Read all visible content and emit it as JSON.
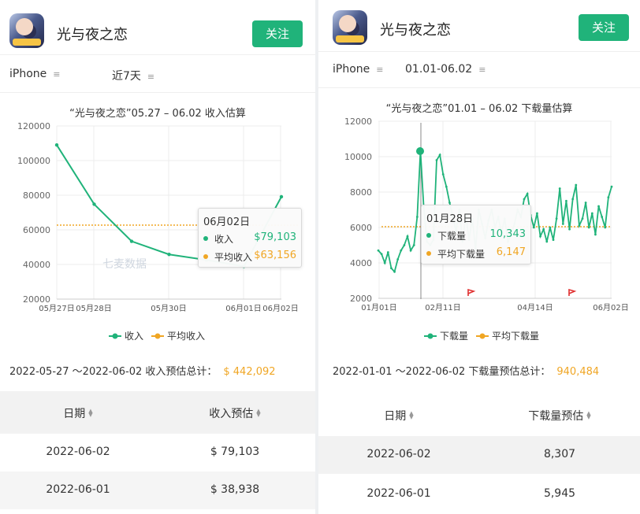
{
  "colors": {
    "green": "#20b37a",
    "orange": "#f0a624"
  },
  "left": {
    "app": {
      "title": "光与夜之恋",
      "follow": "关注",
      "icon": "app-icon"
    },
    "filters": {
      "device": "iPhone",
      "range": "近7天",
      "sort_icon": "≡"
    },
    "chart_data": {
      "type": "line",
      "title": "“光与夜之恋”05.27 – 06.02 收入估算",
      "x_ticks": [
        "05月27日",
        "05月28日",
        "05月30日",
        "06月01日",
        "06月02日"
      ],
      "y_ticks": [
        "120000",
        "100000",
        "80000",
        "60000",
        "40000",
        "20000"
      ],
      "ylim": [
        20000,
        120000
      ],
      "x": [
        "05-27",
        "05-28",
        "05-29",
        "05-30",
        "05-31",
        "06-01",
        "06-02"
      ],
      "series": [
        {
          "name": "收入",
          "values": [
            109000,
            74800,
            53400,
            45800,
            42600,
            38938,
            79103
          ]
        },
        {
          "name": "平均收入",
          "values": [
            63156,
            63156,
            63156,
            63156,
            63156,
            63156,
            63156
          ]
        }
      ],
      "watermark": "七麦数据",
      "tooltip": {
        "date": "06月02日",
        "row1_label": "收入",
        "row1_value": "$79,103",
        "row2_label": "平均收入",
        "row2_value": "$63,156"
      }
    },
    "legend": [
      "收入",
      "平均收入"
    ],
    "total": {
      "label": "2022-05-27 ～2022-06-02 收入预估总计：",
      "value": "$ 442,092"
    },
    "table": {
      "headers": [
        "日期",
        "收入预估"
      ],
      "rows": [
        [
          "2022-06-02",
          "$ 79,103"
        ],
        [
          "2022-06-01",
          "$ 38,938"
        ]
      ]
    }
  },
  "right": {
    "app": {
      "title": "光与夜之恋",
      "follow": "关注",
      "icon": "app-icon"
    },
    "filters": {
      "device": "iPhone",
      "range": "01.01-06.02",
      "sort_icon": "≡"
    },
    "chart_data": {
      "type": "line",
      "title": "“光与夜之恋”01.01 – 06.02 下载量估算",
      "x_ticks": [
        "01月01日",
        "02月11日",
        "04月14日",
        "06月02日"
      ],
      "y_ticks": [
        "12000",
        "10000",
        "8000",
        "6000",
        "4000",
        "2000"
      ],
      "ylim": [
        2000,
        12000
      ],
      "series": [
        {
          "name": "下载量",
          "values": [
            4700,
            4500,
            4000,
            4600,
            3700,
            3500,
            4200,
            4700,
            5000,
            5500,
            4700,
            5000,
            6600,
            10343,
            7200,
            5200,
            5000,
            5300,
            9800,
            10100,
            9000,
            8300,
            7400,
            6600,
            5800,
            7000,
            5200,
            6700,
            5300,
            6500,
            4800,
            7000,
            6200,
            5400,
            6400,
            7000,
            6000,
            6600,
            5700,
            6500,
            5200,
            5600,
            6200,
            7000,
            6600,
            7600,
            7900,
            6700,
            6000,
            6800,
            5500,
            5900,
            5200,
            6000,
            5300,
            6500,
            8200,
            6200,
            7500,
            5900,
            7600,
            8400,
            6100,
            6500,
            7400,
            6000,
            6800,
            5600,
            7200,
            6600,
            6000,
            7700,
            8307
          ]
        },
        {
          "name": "平均下载量",
          "values": [
            6147
          ]
        }
      ],
      "tooltip": {
        "date": "01月28日",
        "row1_label": "下载量",
        "row1_value": "10,343",
        "row2_label": "平均下载量",
        "row2_value": "6,147"
      }
    },
    "legend": [
      "下载量",
      "平均下载量"
    ],
    "total": {
      "label": "2022-01-01 ～2022-06-02 下载量预估总计：",
      "value": "940,484"
    },
    "table": {
      "headers": [
        "日期",
        "下载量预估"
      ],
      "rows": [
        [
          "2022-06-02",
          "8,307"
        ],
        [
          "2022-06-01",
          "5,945"
        ]
      ]
    }
  },
  "icons": {
    "sort": "sort-icon",
    "up_down": "▲▼"
  }
}
